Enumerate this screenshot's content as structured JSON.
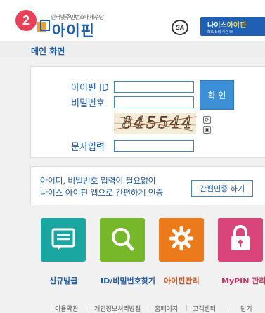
{
  "step_badge": "2",
  "header": {
    "logo_subtitle": "인터넷주민번호대체수단",
    "logo_text": "아이핀",
    "seal_text": "SA",
    "nice_title_main": "나이스",
    "nice_title_accent": "아이핀",
    "nice_subtitle": "NICE평가정보"
  },
  "page_title": "메인 화면",
  "login": {
    "id_label": "아이핀 ID",
    "pw_label": "비밀번호",
    "id_value": "",
    "pw_value": "",
    "confirm_label": "확 인",
    "captcha_text": "845544",
    "refresh_glyph": "⟳",
    "audio_glyph": "◉",
    "captcha_label": "문자입력",
    "captcha_value": ""
  },
  "simple_auth": {
    "line1": "아이디, 비밀번호 입력이 필요없이",
    "line2": "나이스 아이핀 앱으로 간편하게 인증",
    "button_label": "간편인증 하기"
  },
  "tiles": [
    {
      "label": "신규발급",
      "color": "#1aa7a1",
      "icon": "id-card-icon",
      "label_color": "#1e5ba8"
    },
    {
      "label": "ID/비밀번호찾기",
      "color": "#76b82a",
      "icon": "magnifier-icon",
      "label_color": "#1e5ba8"
    },
    {
      "label": "아이핀관리",
      "color": "#ea7a1a",
      "icon": "gear-icon",
      "label_color": "#d2541b"
    },
    {
      "label": "MyPIN 관리",
      "color": "#d9457a",
      "icon": "lock-icon",
      "label_color": "#c8335e"
    }
  ],
  "footer": {
    "links": [
      "이용약관",
      "개인정보처리방침",
      "홈페이지",
      "고객센터",
      "닫기"
    ]
  }
}
